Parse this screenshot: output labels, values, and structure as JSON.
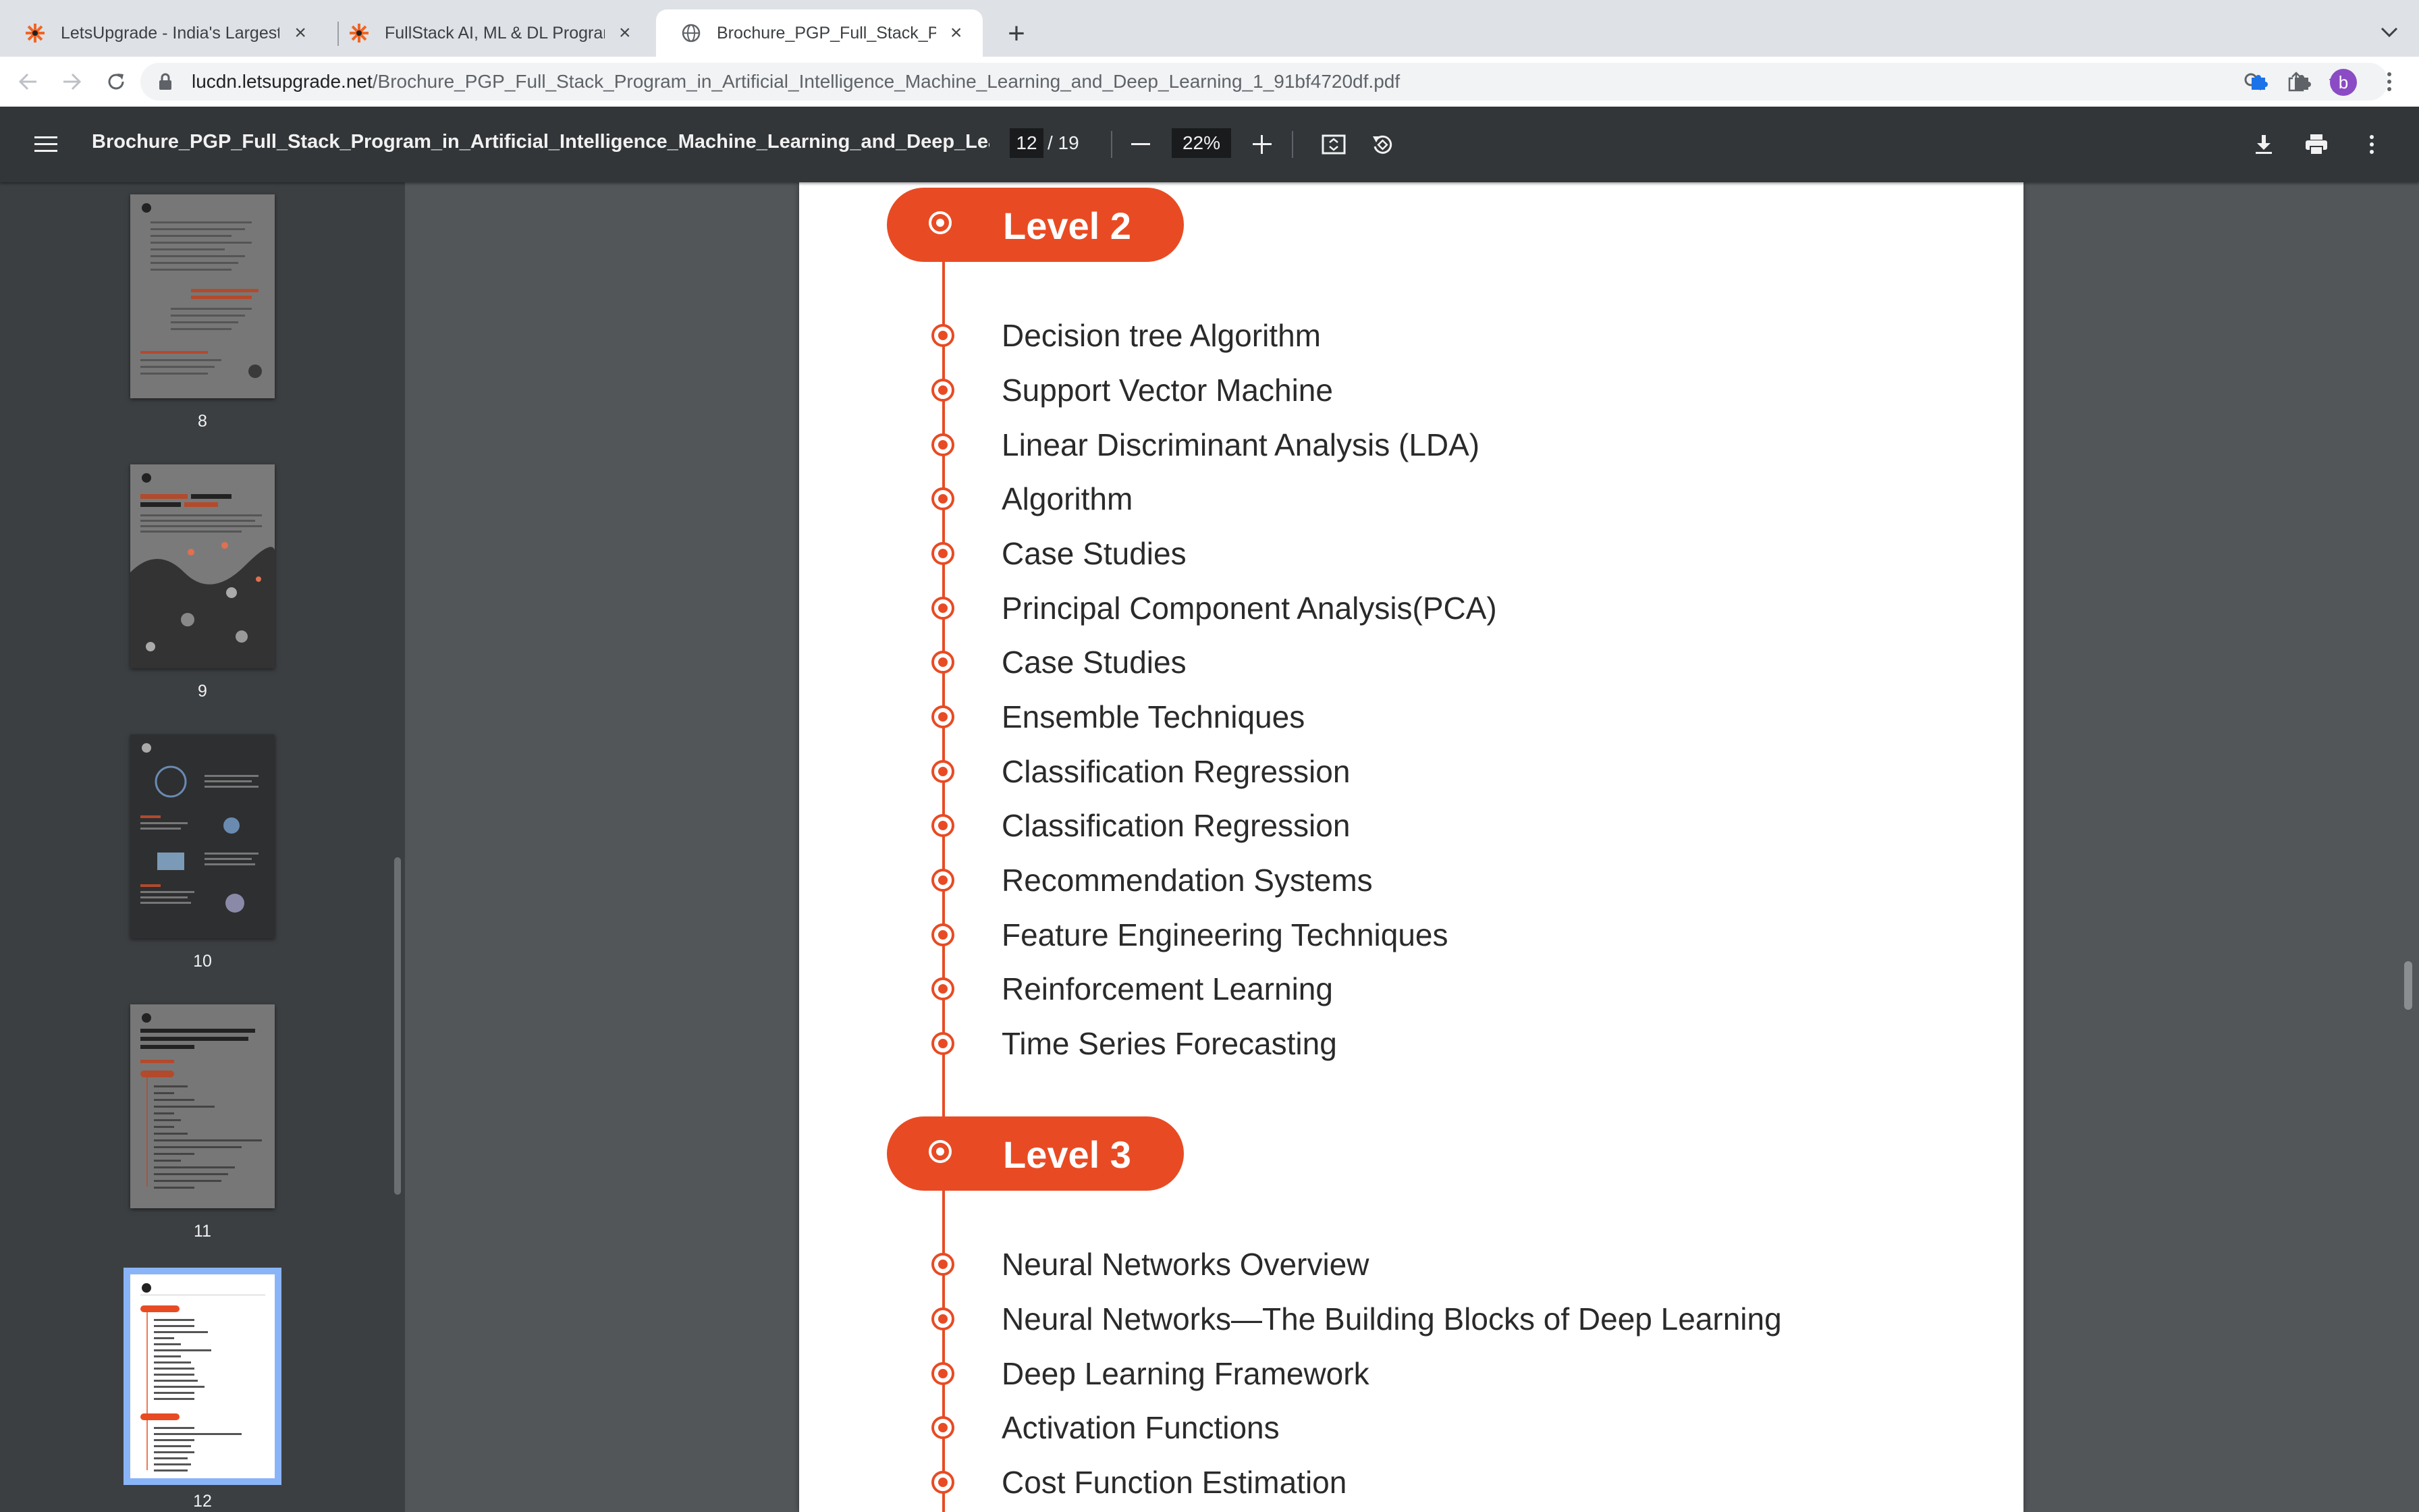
{
  "browser": {
    "tabs": [
      {
        "title": "LetsUpgrade - India's Largest",
        "icon": "letsupgrade-favicon",
        "active": false
      },
      {
        "title": "FullStack AI, ML & DL Program",
        "icon": "letsupgrade-favicon",
        "active": false
      },
      {
        "title": "Brochure_PGP_Full_Stack_Prog",
        "icon": "globe-icon",
        "active": true
      }
    ],
    "url_host": "lucdn.letsupgrade.net",
    "url_path": "/Brochure_PGP_Full_Stack_Program_in_Artificial_Intelligence_Machine_Learning_and_Deep_Learning_1_91bf4720df.pdf",
    "profile_initial": "b"
  },
  "pdf": {
    "title": "Brochure_PGP_Full_Stack_Program_in_Artificial_Intelligence_Machine_Learning_and_Deep_Learning_1_9...",
    "current_page": "12",
    "page_count": "/ 19",
    "zoom": "22%"
  },
  "thumbnails": [
    {
      "number": "8",
      "selected": false
    },
    {
      "number": "9",
      "selected": false
    },
    {
      "number": "10",
      "selected": false
    },
    {
      "number": "11",
      "selected": false
    },
    {
      "number": "12",
      "selected": true
    }
  ],
  "document": {
    "level2": {
      "label": "Level 2",
      "items": [
        "Decision tree Algorithm",
        "Support Vector Machine",
        "Linear Discriminant Analysis (LDA)",
        "Algorithm",
        "Case Studies",
        "Principal Component Analysis(PCA)",
        "Case Studies",
        "Ensemble Techniques",
        "Classification Regression",
        "Classification Regression",
        "Recommendation Systems",
        "Feature Engineering Techniques",
        "Reinforcement Learning",
        "Time Series Forecasting"
      ]
    },
    "level3": {
      "label": "Level 3",
      "items": [
        "Neural Networks Overview",
        "Neural Networks—The Building Blocks of Deep Learning",
        "Deep Learning Framework",
        "Activation Functions",
        "Cost Function Estimation"
      ]
    }
  },
  "colors": {
    "accent": "#e84b24",
    "viewer_bg": "#525659",
    "toolbar_bg": "#323639"
  }
}
